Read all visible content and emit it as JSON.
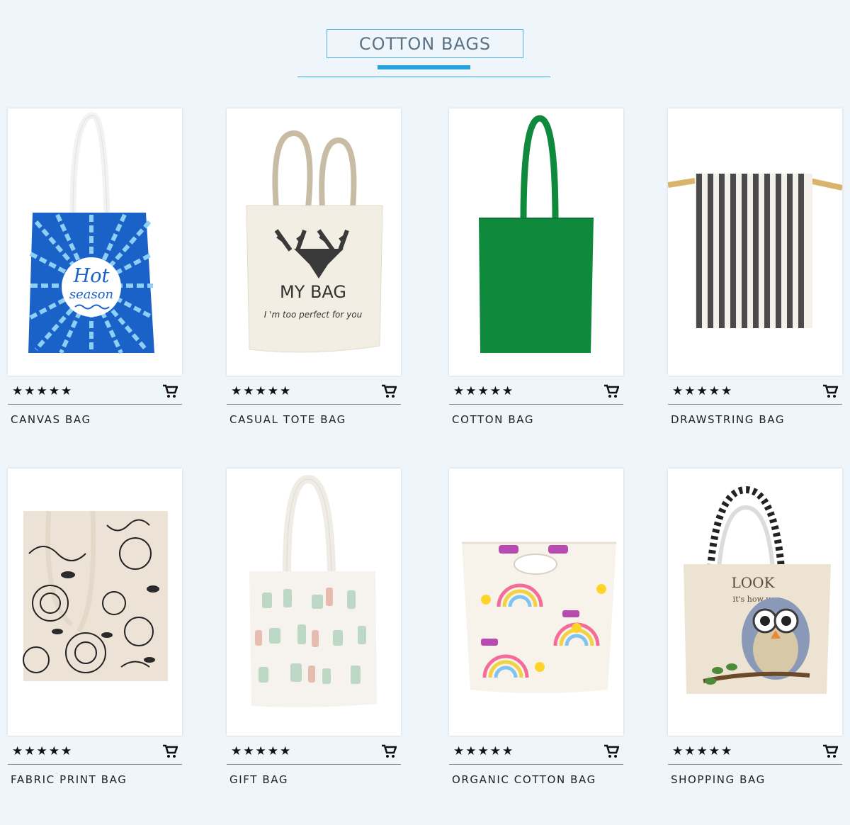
{
  "header": {
    "title": "COTTON BAGS"
  },
  "rating_display": "★★★★★",
  "products": [
    {
      "name": "CANVAS BAG",
      "print_text_1": "Hot",
      "print_text_2": "season"
    },
    {
      "name": "CASUAL TOTE BAG",
      "print_text_1": "MY BAG",
      "print_text_2": "I 'm too perfect for you"
    },
    {
      "name": "COTTON BAG"
    },
    {
      "name": "DRAWSTRING BAG"
    },
    {
      "name": "FABRIC PRINT BAG"
    },
    {
      "name": "GIFT BAG"
    },
    {
      "name": "ORGANIC COTTON BAG"
    },
    {
      "name": "SHOPPING BAG",
      "print_text_1": "LOOK",
      "print_text_2": "it's how you"
    }
  ],
  "colors": {
    "accent": "#29a3e0",
    "background": "#eef6fc",
    "green_bag": "#0f8a3c"
  },
  "icons": {
    "rating": "star-icon",
    "cart": "cart-icon"
  }
}
